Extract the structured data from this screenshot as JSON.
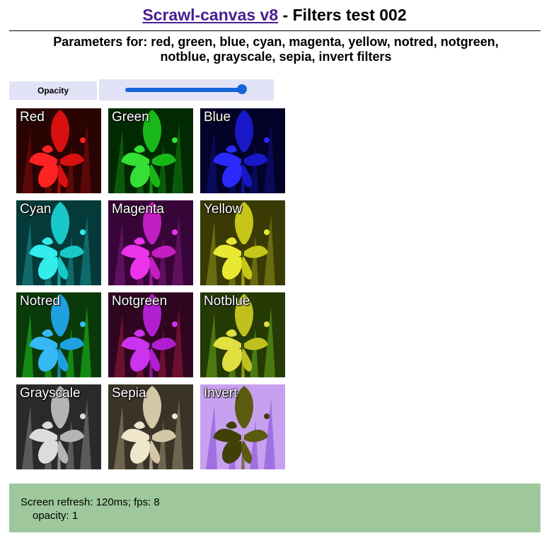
{
  "header": {
    "link_text": "Scrawl-canvas v8",
    "title_rest": " - Filters test 002",
    "subtitle": "Parameters for: red, green, blue, cyan, magenta, yellow, notred, notgreen, notblue, grayscale, sepia, invert filters"
  },
  "controls": {
    "opacity_label": "Opacity",
    "opacity_value": 1
  },
  "filters": [
    {
      "label": "Red",
      "bg": "#2a0303",
      "leaf": "#5a0808",
      "flower": "#d91010",
      "petal": "#ff2222"
    },
    {
      "label": "Green",
      "bg": "#022a02",
      "leaf": "#0a5a0a",
      "flower": "#18b818",
      "petal": "#33e033"
    },
    {
      "label": "Blue",
      "bg": "#03032a",
      "leaf": "#0a0a5a",
      "flower": "#1818c8",
      "petal": "#2a2aff"
    },
    {
      "label": "Cyan",
      "bg": "#053a3a",
      "leaf": "#106a6a",
      "flower": "#19c8c8",
      "petal": "#33ecec"
    },
    {
      "label": "Magenta",
      "bg": "#380538",
      "leaf": "#5e105e",
      "flower": "#c21ec2",
      "petal": "#ea33ea"
    },
    {
      "label": "Yellow",
      "bg": "#3a3a05",
      "leaf": "#6a6a10",
      "flower": "#c6c619",
      "petal": "#e9e933"
    },
    {
      "label": "Notred",
      "bg": "#0a3a0a",
      "leaf": "#148a14",
      "flower": "#1fa0e0",
      "petal": "#35b8f5"
    },
    {
      "label": "Notgreen",
      "bg": "#300520",
      "leaf": "#6a1030",
      "flower": "#b01ed0",
      "petal": "#cc33ee"
    },
    {
      "label": "Notblue",
      "bg": "#253a05",
      "leaf": "#4a7a10",
      "flower": "#c0c020",
      "petal": "#e0e040"
    },
    {
      "label": "Grayscale",
      "bg": "#2a2a2a",
      "leaf": "#5a5a5a",
      "flower": "#b5b5b5",
      "petal": "#dcdcdc"
    },
    {
      "label": "Sepia",
      "bg": "#3a3428",
      "leaf": "#6e6450",
      "flower": "#d4c8a8",
      "petal": "#efe6cc"
    },
    {
      "label": "Invert",
      "bg": "#c8a0f0",
      "leaf": "#a070e0",
      "flower": "#5a5a10",
      "petal": "#404008"
    }
  ],
  "report": {
    "line1": "Screen refresh: 120ms; fps: 8",
    "line2": "opacity: 1"
  }
}
